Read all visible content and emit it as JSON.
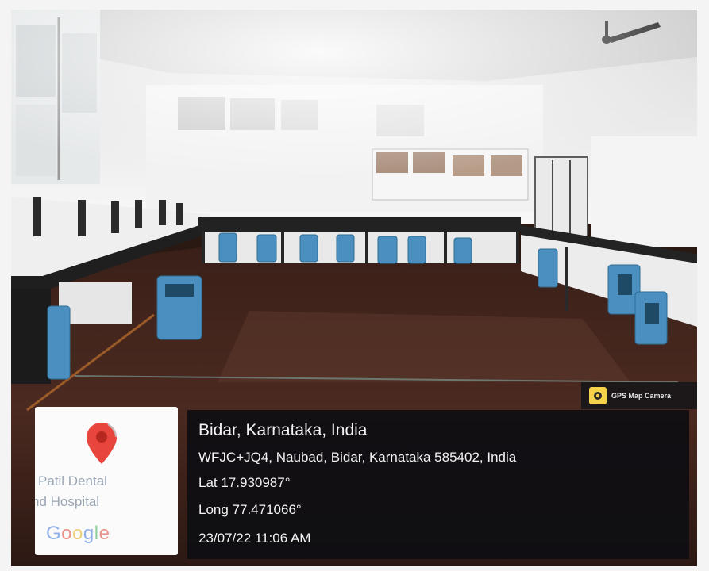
{
  "badge": {
    "label": "GPS Map Camera",
    "icon": "camera-icon"
  },
  "map_card": {
    "place_line1": "Patil Dental",
    "place_line2": "nd Hospital",
    "logo_text": "Google",
    "pin_color": "#e8453c"
  },
  "location": {
    "title": "Bidar, Karnataka, India",
    "address": "WFJC+JQ4, Naubad, Bidar, Karnataka 585402, India",
    "lat": "Lat 17.930987°",
    "long": "Long 77.471066°",
    "datetime": "23/07/22 11:06 AM"
  }
}
